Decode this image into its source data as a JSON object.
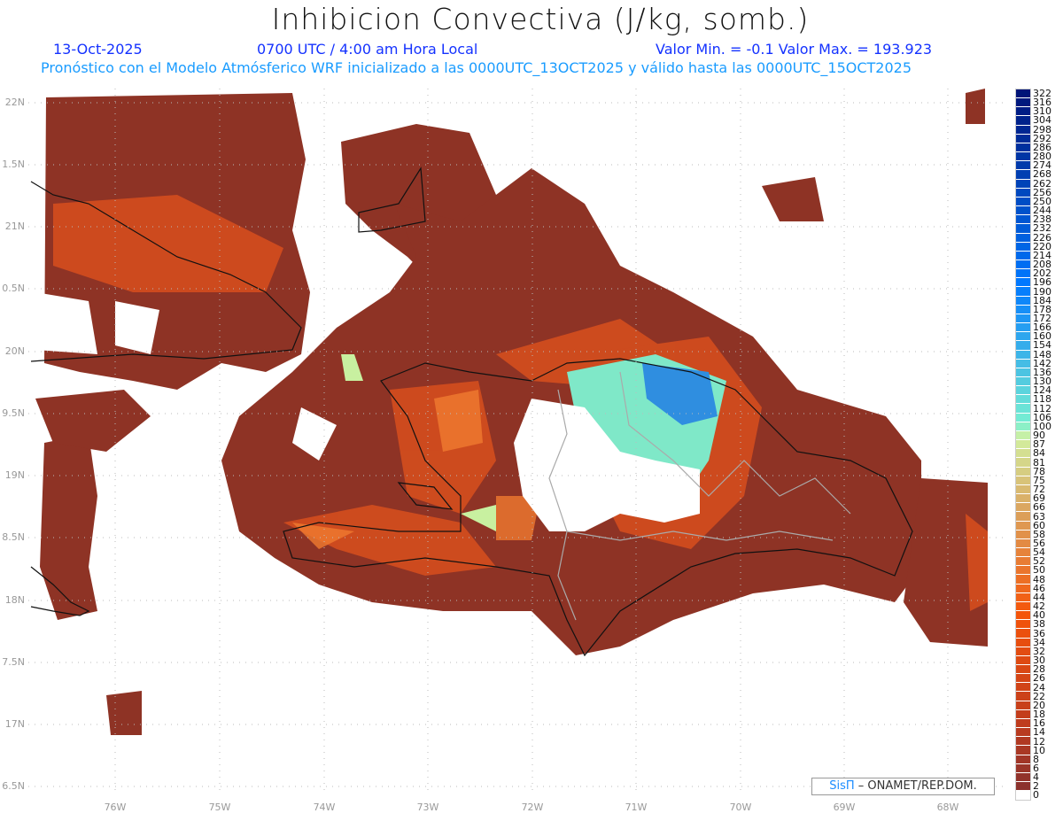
{
  "title": "Inhibicion Convectiva (J/kg, somb.)",
  "date": "13-Oct-2025",
  "time": "0700 UTC / 4:00 am Hora Local",
  "minmax": "Valor Min. = -0.1  Valor Max. = 193.923",
  "subtitle": "Pronóstico con el Modelo Atmósferico WRF inicializado a las 0000UTC_13OCT2025 y válido hasta las  0000UTC_15OCT2025",
  "lat_labels": [
    "22N",
    "1.5N",
    "21N",
    "0.5N",
    "20N",
    "9.5N",
    "19N",
    "8.5N",
    "18N",
    "7.5N",
    "17N",
    "6.5N"
  ],
  "lon_labels": [
    "76W",
    "75W",
    "74W",
    "73W",
    "72W",
    "71W",
    "70W",
    "69W",
    "68W"
  ],
  "colorbar": {
    "levels": [
      "322",
      "316",
      "310",
      "304",
      "298",
      "292",
      "286",
      "280",
      "274",
      "268",
      "262",
      "256",
      "250",
      "244",
      "238",
      "232",
      "226",
      "220",
      "214",
      "208",
      "202",
      "196",
      "190",
      "184",
      "178",
      "172",
      "166",
      "160",
      "154",
      "148",
      "142",
      "136",
      "130",
      "124",
      "118",
      "112",
      "106",
      "100",
      "90",
      "87",
      "84",
      "81",
      "78",
      "75",
      "72",
      "69",
      "66",
      "63",
      "60",
      "58",
      "56",
      "54",
      "52",
      "50",
      "48",
      "46",
      "44",
      "42",
      "40",
      "38",
      "36",
      "34",
      "32",
      "30",
      "28",
      "26",
      "24",
      "22",
      "20",
      "18",
      "16",
      "14",
      "12",
      "10",
      "8",
      "6",
      "4",
      "2",
      "0"
    ]
  },
  "credit": {
    "brand": "SisΠ",
    "text": " – ONAMET/REP.DOM."
  }
}
